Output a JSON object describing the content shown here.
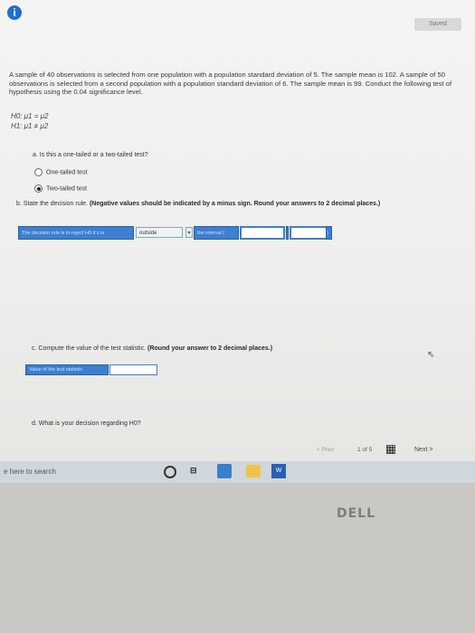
{
  "header": {
    "info_icon": "i",
    "saved_label": "Saved"
  },
  "problem": {
    "text": "A sample of 40 observations is selected from one population with a population standard deviation of 5. The sample mean is 102. A sample of 50 observations is selected from a second population with a population standard deviation of 6. The sample mean is 99. Conduct the following test of hypothesis using the 0.04 significance level.",
    "h0": "H0: μ1 = μ2",
    "h1": "H1: μ1 ≠ μ2"
  },
  "part_a": {
    "question": "a. Is this a one-tailed or a two-tailed test?",
    "options": [
      "One-tailed test",
      "Two-tailed test"
    ],
    "selected_index": 1
  },
  "part_b": {
    "question": "b. State the decision rule.",
    "note": "(Negative values should be indicated by a minus sign. Round your answers to 2 decimal places.)",
    "rule_prefix": "The decision rule is to reject H0 if z is",
    "rule_select_value": "outside",
    "rule_interval": "the interval (",
    "input1_value": "",
    "input2_value": "",
    "rule_end": ")"
  },
  "part_c": {
    "question": "c. Compute the value of the test statistic.",
    "note": "(Round your answer to 2 decimal places.)",
    "stat_label": "Value of the test statistic",
    "stat_value": ""
  },
  "part_d": {
    "question": "d. What is your decision regarding H0?"
  },
  "nav": {
    "prev_label": "< Prev",
    "page_label": "1 of 5",
    "next_label": "Next >"
  },
  "taskbar": {
    "search_placeholder": "e here to search",
    "word_icon": "W"
  },
  "bezel": {
    "brand": "DELL"
  }
}
